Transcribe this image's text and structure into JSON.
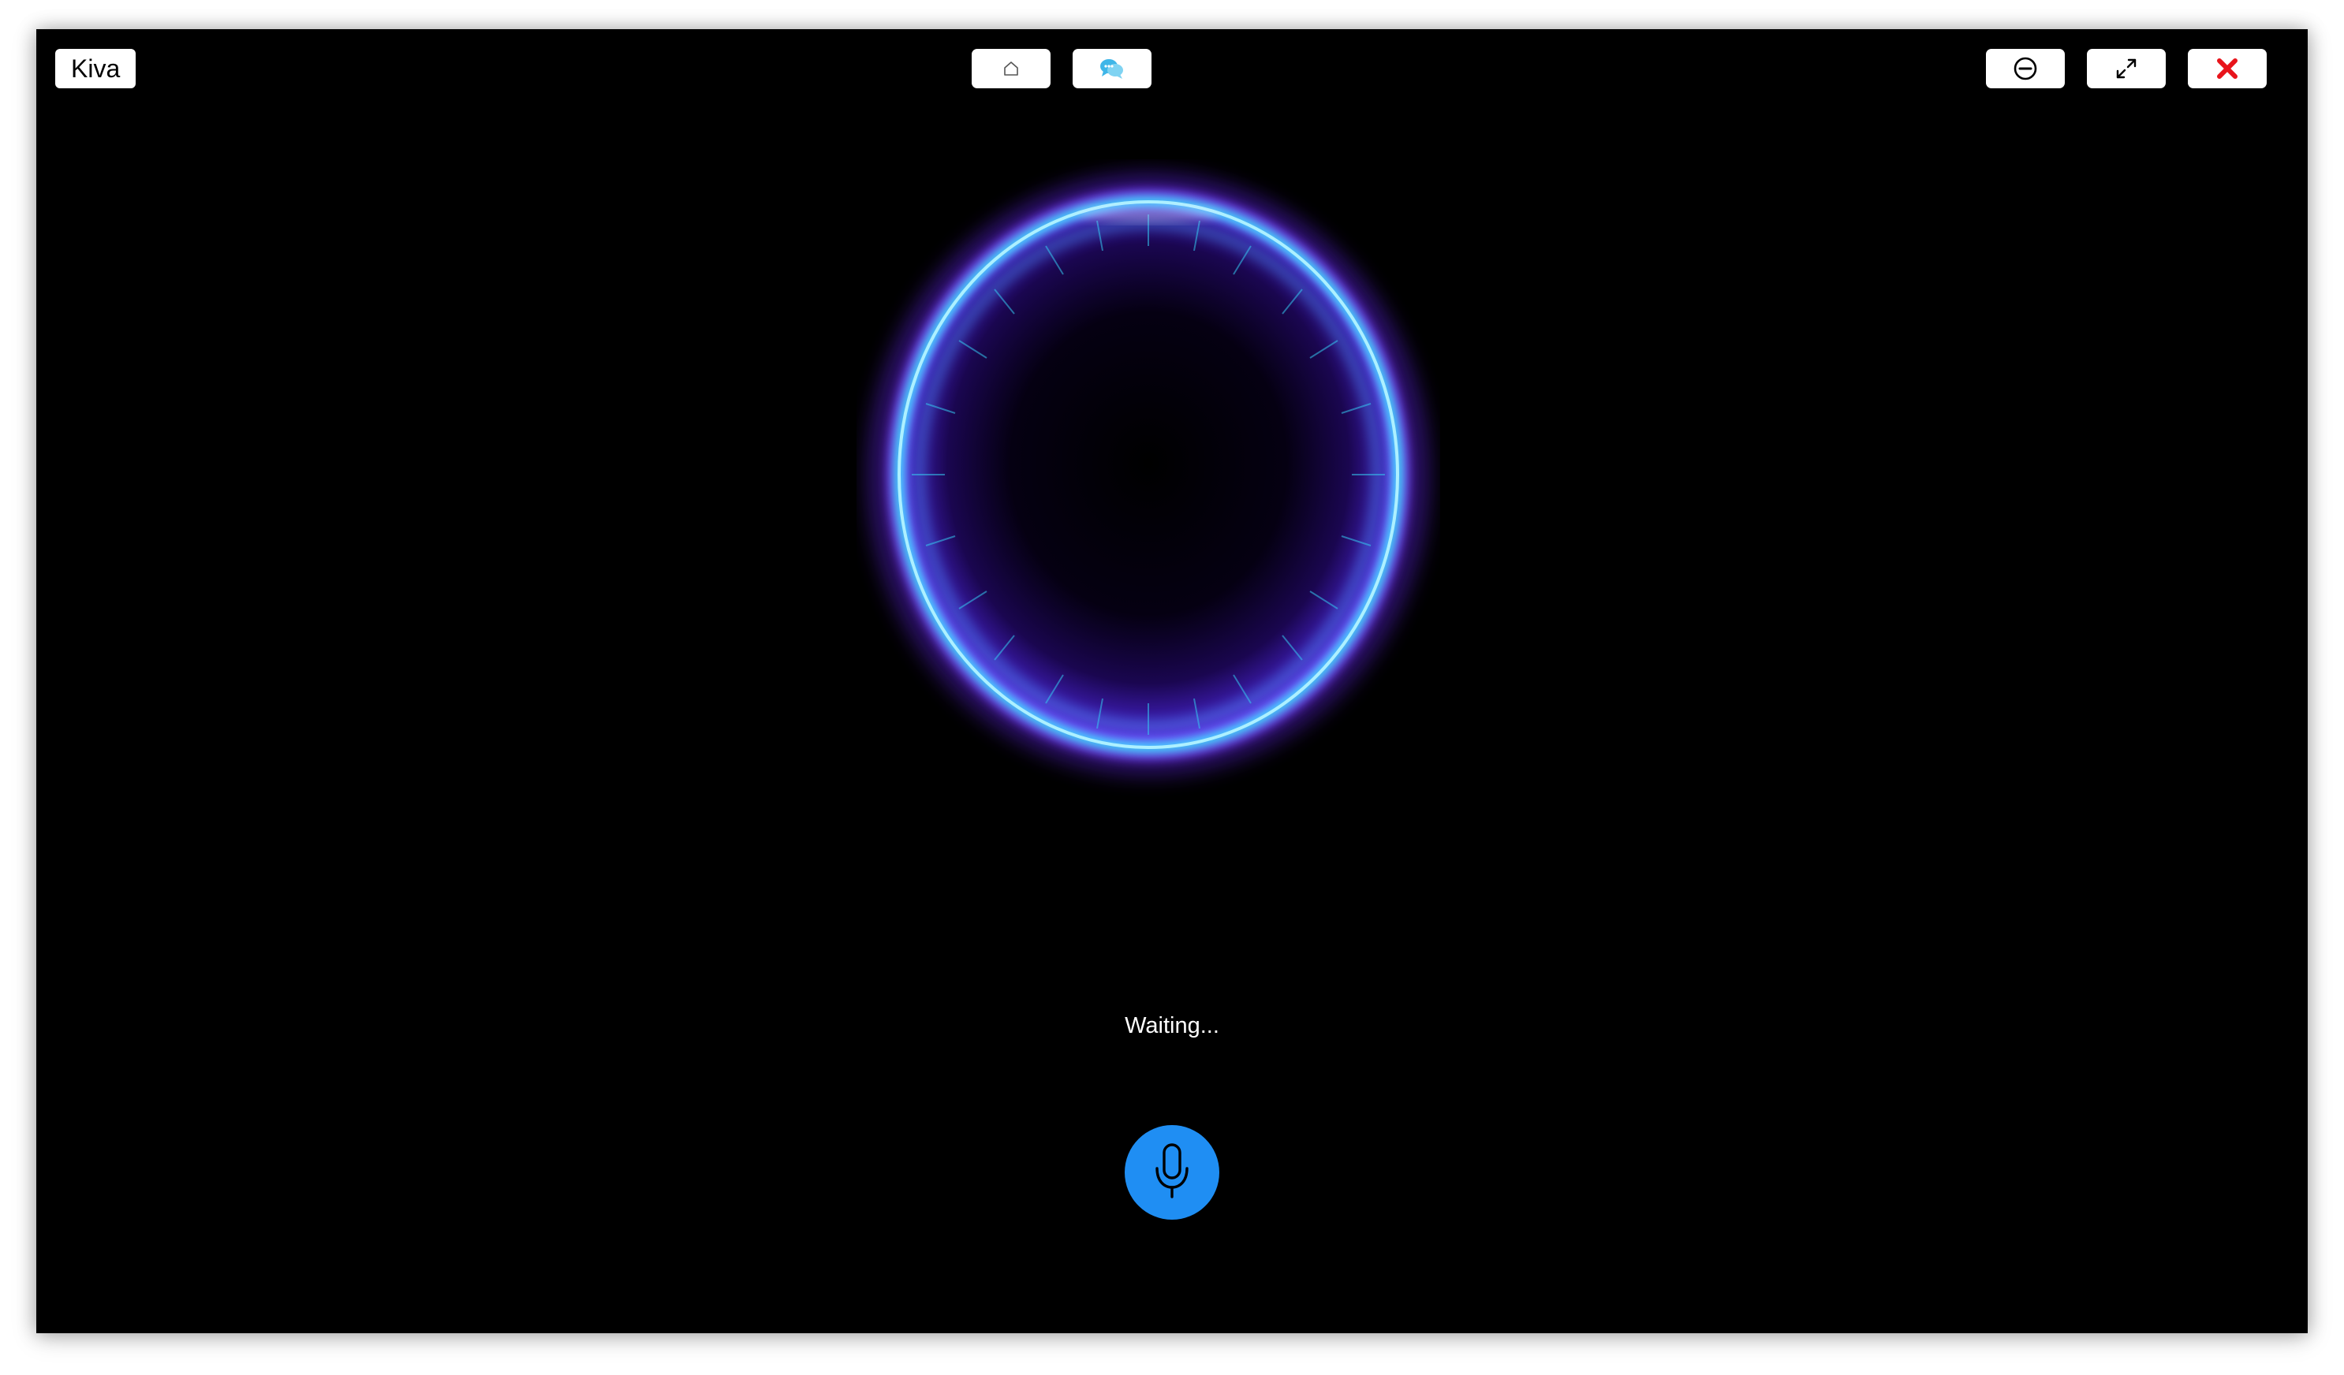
{
  "app": {
    "title": "Kiva"
  },
  "toolbar": {
    "home_icon": "home-icon",
    "chat_icon": "chat-bubbles-icon",
    "minimize_icon": "minus-circle-icon",
    "fullscreen_icon": "expand-arrows-icon",
    "close_icon": "red-x-icon"
  },
  "assistant": {
    "visual": "glowing-ring-orb",
    "status": "Waiting...",
    "mic_icon": "microphone-icon"
  },
  "colors": {
    "background": "#000000",
    "mic_button": "#1f8ef3",
    "orb_cyan": "#3fe0ff",
    "orb_purple": "#7a3cff",
    "close_red": "#e8141b"
  }
}
